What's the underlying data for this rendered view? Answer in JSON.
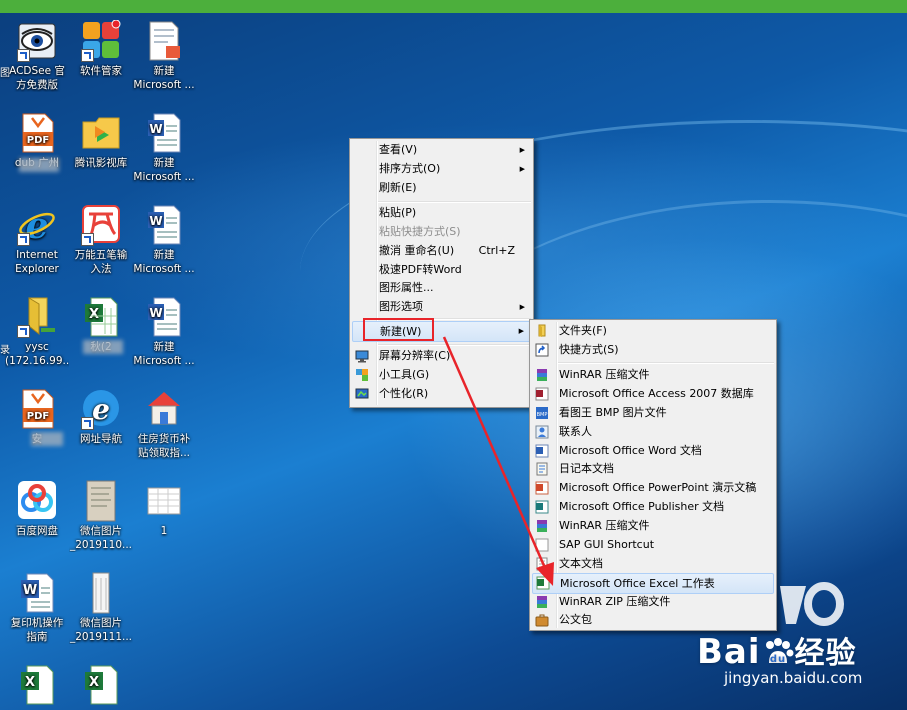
{
  "desktop": {
    "icons": [
      {
        "label1": "ACDSee 官",
        "label2": "方免费版",
        "kind": "acdsee"
      },
      {
        "label1": "软件管家",
        "label2": "",
        "kind": "tencent"
      },
      {
        "label1": "新建",
        "label2": "Microsoft ...",
        "kind": "doc"
      },
      {
        "label1": "",
        "label2": "",
        "kind": "pdf"
      },
      {
        "label1": "腾讯影视库",
        "label2": "",
        "kind": "folder"
      },
      {
        "label1": "新建",
        "label2": "Microsoft ...",
        "kind": "doc"
      },
      {
        "label1": "Internet",
        "label2": "Explorer",
        "kind": "ie"
      },
      {
        "label1": "万能五笔输",
        "label2": "入法",
        "kind": "wubi"
      },
      {
        "label1": "新建",
        "label2": "Microsoft ...",
        "kind": "doc"
      },
      {
        "label1": "yysc",
        "label2": "(172.16.99...",
        "kind": "netfolder"
      },
      {
        "label1": "",
        "label2": "",
        "kind": "xls"
      },
      {
        "label1": "新建",
        "label2": "Microsoft ...",
        "kind": "doc"
      },
      {
        "label1": "安",
        "label2": "",
        "kind": "pdf"
      },
      {
        "label1": "网址导航",
        "label2": "",
        "kind": "ienav"
      },
      {
        "label1": "住房货币补",
        "label2": "贴领取指...",
        "kind": "house"
      },
      {
        "label1": "百度网盘",
        "label2": "",
        "kind": "baidu"
      },
      {
        "label1": "微信图片",
        "label2": "_2019110...",
        "kind": "photo"
      },
      {
        "label1": "1",
        "label2": "",
        "kind": "blank"
      },
      {
        "label1": "复印机操作",
        "label2": "指南",
        "kind": "word"
      },
      {
        "label1": "微信图片",
        "label2": "_2019111...",
        "kind": "photo2"
      },
      {
        "label1": "",
        "label2": "",
        "kind": "xls"
      },
      {
        "label1": "",
        "label2": "",
        "kind": "xls"
      }
    ],
    "left_edge_fragments": [
      "图",
      "录"
    ],
    "fragment_labels": {
      "pdf_partial": "dub    广州",
      "xls_partial": "秋(2"
    }
  },
  "context_menu": {
    "items": [
      {
        "label": "查看(V)",
        "submenu": true
      },
      {
        "label": "排序方式(O)",
        "submenu": true
      },
      {
        "label": "刷新(E)"
      },
      {
        "label": "粘贴(P)"
      },
      {
        "label": "粘贴快捷方式(S)",
        "disabled": true
      },
      {
        "label": "撤消 重命名(U)",
        "shortcut": "Ctrl+Z"
      },
      {
        "label": "极速PDF转Word"
      },
      {
        "label": "图形属性..."
      },
      {
        "label": "图形选项",
        "submenu": true
      },
      {
        "label": "新建(W)",
        "submenu": true,
        "highlighted": true
      },
      {
        "label": "屏幕分辨率(C)",
        "icon": "screen-icon"
      },
      {
        "label": "小工具(G)",
        "icon": "gadget-icon"
      },
      {
        "label": "个性化(R)",
        "icon": "personalize-icon"
      }
    ]
  },
  "new_submenu": {
    "items": [
      {
        "label": "文件夹(F)",
        "icon": "folder-icon"
      },
      {
        "label": "快捷方式(S)",
        "icon": "shortcut-icon"
      },
      {
        "label": "WinRAR 压缩文件",
        "icon": "winrar-icon"
      },
      {
        "label": "Microsoft Office Access 2007 数据库",
        "icon": "access-icon"
      },
      {
        "label": "看图王 BMP 图片文件",
        "icon": "bmp-icon"
      },
      {
        "label": "联系人",
        "icon": "contact-icon"
      },
      {
        "label": "Microsoft Office Word 文档",
        "icon": "word-icon"
      },
      {
        "label": "日记本文档",
        "icon": "journal-icon"
      },
      {
        "label": "Microsoft Office PowerPoint 演示文稿",
        "icon": "powerpoint-icon"
      },
      {
        "label": "Microsoft Office Publisher 文档",
        "icon": "publisher-icon"
      },
      {
        "label": "WinRAR 压缩文件",
        "icon": "winrar-icon"
      },
      {
        "label": "SAP GUI Shortcut",
        "icon": "sap-icon"
      },
      {
        "label": "文本文档",
        "icon": "text-icon"
      },
      {
        "label": "Microsoft Office Excel 工作表",
        "icon": "excel-icon",
        "highlighted": true
      },
      {
        "label": "WinRAR ZIP 压缩文件",
        "icon": "winrar-zip-icon"
      },
      {
        "label": "公文包",
        "icon": "briefcase-icon"
      }
    ]
  },
  "watermark": {
    "brand": "Bai",
    "brand2": "经验",
    "url": "jingyan.baidu.com"
  },
  "colors": {
    "annotation_red": "#e8242a",
    "menu_bg": "#f0f0f0",
    "topbar": "#4caf3c"
  }
}
